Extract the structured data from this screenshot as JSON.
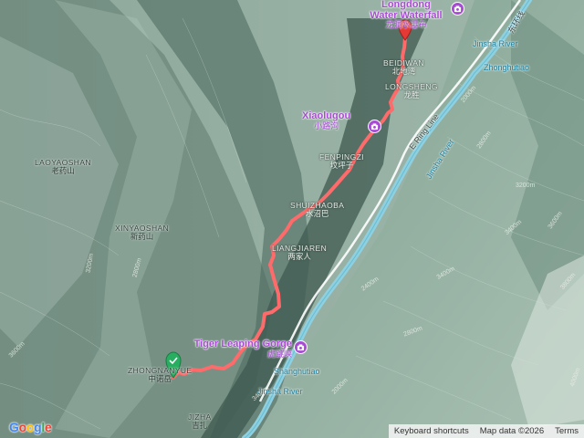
{
  "map": {
    "places": {
      "longdong": {
        "en": "Longdong",
        "en2": "Water Waterfall",
        "zh": "龙洞水瀑布"
      },
      "beidiwan": {
        "en": "BEIDIWAN",
        "zh": "北地湾"
      },
      "longsheng": {
        "en": "LONGSHENG",
        "zh": "龙胜"
      },
      "xiaolugou": {
        "en": "Xiaolugou",
        "zh": "小路沟"
      },
      "laoyaoshan": {
        "en": "LAOYAOSHAN",
        "zh": "老药山"
      },
      "fenpingzi": {
        "en": "FENPINGZI",
        "zh": "坟坪子"
      },
      "shuizhaoba": {
        "en": "SHUIZHAOBA",
        "zh": "水沼巴"
      },
      "xinyaoshan": {
        "en": "XINYAOSHAN",
        "zh": "新药山"
      },
      "liangjiaren": {
        "en": "LIANGJIAREN",
        "zh": "两家人"
      },
      "tigerleaping": {
        "en": "Tiger Leaping Gorge",
        "zh": "虎跳峡"
      },
      "shanghutiao": {
        "en": "Shanghutiao"
      },
      "zhongnan": {
        "en": "ZHONGNANYUE",
        "zh": "中诺岳"
      },
      "jizha": {
        "en": "JIZHA",
        "zh": "吉扎"
      },
      "zhonghutiao": {
        "en": "Zhonghutiao"
      },
      "river_top": {
        "en": "Jinsha River"
      },
      "river_mid": {
        "en": "Jinsha River"
      },
      "river_bottom": {
        "en": "Jinsha River"
      },
      "eringroad": {
        "en": "E Ring Line"
      },
      "eringroad_zh": {
        "zh": "东环线"
      }
    },
    "contours": [
      "2000m",
      "2800m",
      "3200m",
      "3400m",
      "3600m",
      "3800m",
      "4000m",
      "3400m",
      "2800m",
      "2400m",
      "2000m",
      "3200m",
      "2800m",
      "3600m",
      "3400m"
    ],
    "colors": {
      "route": "#ff6b6b",
      "start_marker": "#27ae60",
      "end_marker": "#e53935",
      "poi": "#a64bd2",
      "river": "#8fd0e0"
    },
    "footer": {
      "shortcuts": "Keyboard shortcuts",
      "mapdata": "Map data ©2026",
      "terms": "Terms"
    },
    "logo": "Google"
  }
}
